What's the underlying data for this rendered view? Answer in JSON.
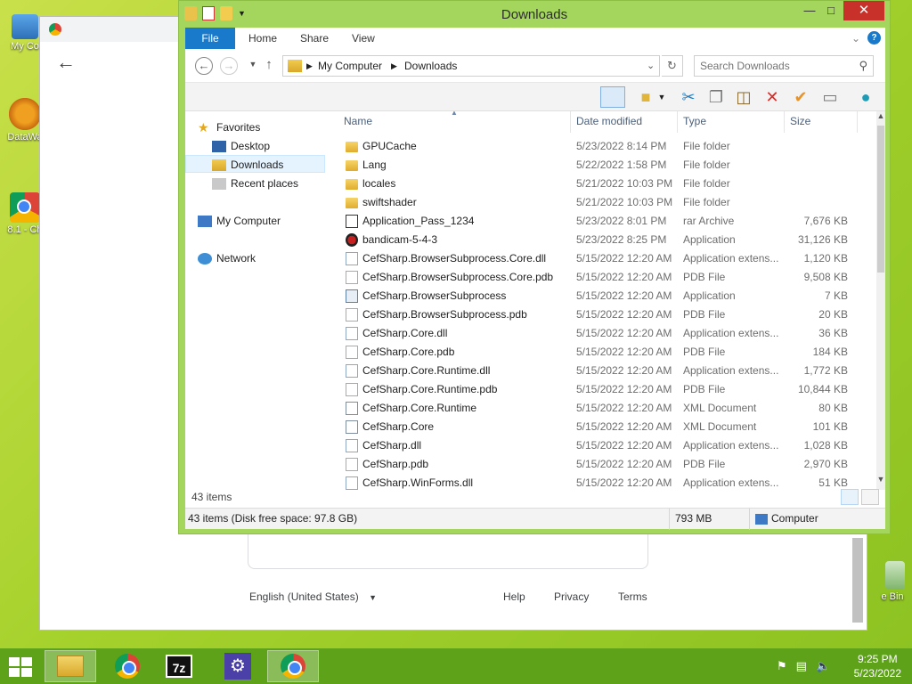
{
  "desktop": {
    "icons": [
      {
        "label": "My Co"
      },
      {
        "label": "DataWa"
      },
      {
        "label": "8.1 - Ch"
      },
      {
        "label": "e Bin"
      }
    ]
  },
  "chrome": {
    "footer": {
      "language": "English (United States)",
      "help": "Help",
      "privacy": "Privacy",
      "terms": "Terms"
    }
  },
  "explorer": {
    "title": "Downloads",
    "ribbon": {
      "tabs": [
        "File",
        "Home",
        "Share",
        "View"
      ]
    },
    "address": {
      "segments": [
        "My Computer",
        "Downloads"
      ]
    },
    "search": {
      "placeholder": "Search Downloads"
    },
    "nav": {
      "favorites": "Favorites",
      "desktop": "Desktop",
      "downloads": "Downloads",
      "recent": "Recent places",
      "computer": "My Computer",
      "network": "Network"
    },
    "columns": {
      "name": "Name",
      "date": "Date modified",
      "type": "Type",
      "size": "Size"
    },
    "files": [
      {
        "name": "GPUCache",
        "date": "5/23/2022 8:14 PM",
        "type": "File folder",
        "size": "",
        "icon": "folder"
      },
      {
        "name": "Lang",
        "date": "5/22/2022 1:58 PM",
        "type": "File folder",
        "size": "",
        "icon": "folder"
      },
      {
        "name": "locales",
        "date": "5/21/2022 10:03 PM",
        "type": "File folder",
        "size": "",
        "icon": "folder"
      },
      {
        "name": "swiftshader",
        "date": "5/21/2022 10:03 PM",
        "type": "File folder",
        "size": "",
        "icon": "folder"
      },
      {
        "name": "Application_Pass_1234",
        "date": "5/23/2022 8:01 PM",
        "type": "rar Archive",
        "size": "7,676 KB",
        "icon": "archive"
      },
      {
        "name": "bandicam-5-4-3",
        "date": "5/23/2022 8:25 PM",
        "type": "Application",
        "size": "31,126 KB",
        "icon": "bandicam"
      },
      {
        "name": "CefSharp.BrowserSubprocess.Core.dll",
        "date": "5/15/2022 12:20 AM",
        "type": "Application extens...",
        "size": "1,120 KB",
        "icon": "dll"
      },
      {
        "name": "CefSharp.BrowserSubprocess.Core.pdb",
        "date": "5/15/2022 12:20 AM",
        "type": "PDB File",
        "size": "9,508 KB",
        "icon": "file"
      },
      {
        "name": "CefSharp.BrowserSubprocess",
        "date": "5/15/2022 12:20 AM",
        "type": "Application",
        "size": "7 KB",
        "icon": "app"
      },
      {
        "name": "CefSharp.BrowserSubprocess.pdb",
        "date": "5/15/2022 12:20 AM",
        "type": "PDB File",
        "size": "20 KB",
        "icon": "file"
      },
      {
        "name": "CefSharp.Core.dll",
        "date": "5/15/2022 12:20 AM",
        "type": "Application extens...",
        "size": "36 KB",
        "icon": "dll"
      },
      {
        "name": "CefSharp.Core.pdb",
        "date": "5/15/2022 12:20 AM",
        "type": "PDB File",
        "size": "184 KB",
        "icon": "file"
      },
      {
        "name": "CefSharp.Core.Runtime.dll",
        "date": "5/15/2022 12:20 AM",
        "type": "Application extens...",
        "size": "1,772 KB",
        "icon": "dll"
      },
      {
        "name": "CefSharp.Core.Runtime.pdb",
        "date": "5/15/2022 12:20 AM",
        "type": "PDB File",
        "size": "10,844 KB",
        "icon": "file"
      },
      {
        "name": "CefSharp.Core.Runtime",
        "date": "5/15/2022 12:20 AM",
        "type": "XML Document",
        "size": "80 KB",
        "icon": "xml"
      },
      {
        "name": "CefSharp.Core",
        "date": "5/15/2022 12:20 AM",
        "type": "XML Document",
        "size": "101 KB",
        "icon": "xml"
      },
      {
        "name": "CefSharp.dll",
        "date": "5/15/2022 12:20 AM",
        "type": "Application extens...",
        "size": "1,028 KB",
        "icon": "dll"
      },
      {
        "name": "CefSharp.pdb",
        "date": "5/15/2022 12:20 AM",
        "type": "PDB File",
        "size": "2,970 KB",
        "icon": "file"
      },
      {
        "name": "CefSharp.WinForms.dll",
        "date": "5/15/2022 12:20 AM",
        "type": "Application extens...",
        "size": "51 KB",
        "icon": "dll"
      }
    ],
    "items_count": "43 items",
    "status": {
      "left": "43 items (Disk free space: 97.8 GB)",
      "size": "793 MB",
      "location": "Computer"
    }
  },
  "taskbar": {
    "time": "9:25 PM",
    "date": "5/23/2022"
  },
  "colors": {
    "accent": "#1979ca",
    "window_frame": "#a4d65e",
    "taskbar": "#5ea21a",
    "close": "#c7312a"
  }
}
